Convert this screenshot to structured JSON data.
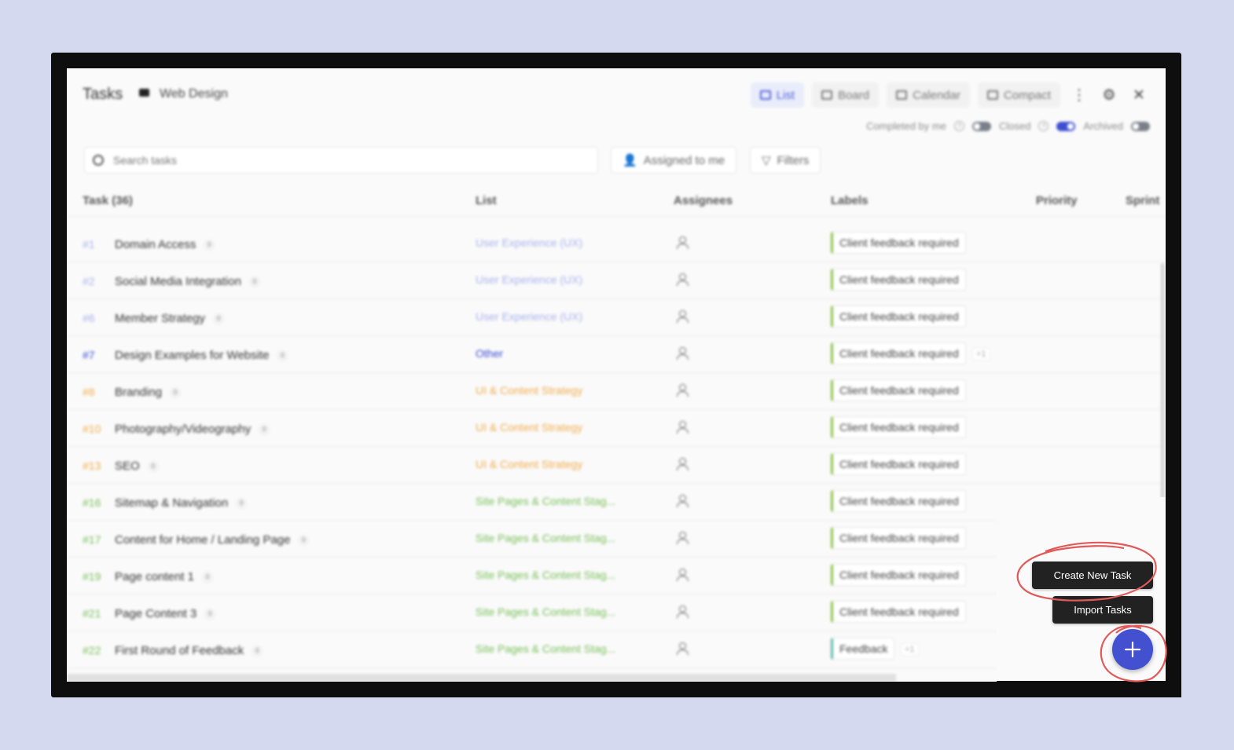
{
  "header": {
    "title": "Tasks",
    "project_name": "Web Design"
  },
  "views": [
    {
      "label": "List",
      "active": true
    },
    {
      "label": "Board",
      "active": false
    },
    {
      "label": "Calendar",
      "active": false
    },
    {
      "label": "Compact",
      "active": false
    }
  ],
  "toggles": [
    {
      "label": "Completed by me",
      "on": false
    },
    {
      "label": "Closed",
      "on": true
    },
    {
      "label": "Archived",
      "on": false
    }
  ],
  "search": {
    "placeholder": "Search tasks"
  },
  "filters": {
    "assigned_label": "Assigned to me",
    "filters_label": "Filters"
  },
  "table": {
    "columns": {
      "task": "Task (36)",
      "list": "List",
      "assignees": "Assignees",
      "labels": "Labels",
      "priority": "Priority",
      "sprint": "Sprint"
    },
    "rows": [
      {
        "id": "#1",
        "name": "Domain Access",
        "count": "0",
        "list": "User Experience (UX)",
        "list_color": "#aab2ec",
        "label": "Client feedback required",
        "label_color": "#8bc34a",
        "extra": ""
      },
      {
        "id": "#2",
        "name": "Social Media Integration",
        "count": "0",
        "list": "User Experience (UX)",
        "list_color": "#aab2ec",
        "label": "Client feedback required",
        "label_color": "#8bc34a",
        "extra": ""
      },
      {
        "id": "#6",
        "name": "Member Strategy",
        "count": "0",
        "list": "User Experience (UX)",
        "list_color": "#aab2ec",
        "label": "Client feedback required",
        "label_color": "#8bc34a",
        "extra": ""
      },
      {
        "id": "#7",
        "name": "Design Examples for Website",
        "count": "0",
        "list": "Other",
        "list_color": "#3a4ad0",
        "label": "Client feedback required",
        "label_color": "#8bc34a",
        "extra": "+1"
      },
      {
        "id": "#8",
        "name": "Branding",
        "count": "0",
        "list": "UI & Content Strategy",
        "list_color": "#f1ac4c",
        "label": "Client feedback required",
        "label_color": "#8bc34a",
        "extra": ""
      },
      {
        "id": "#10",
        "name": "Photography/Videography",
        "count": "0",
        "list": "UI & Content Strategy",
        "list_color": "#f1ac4c",
        "label": "Client feedback required",
        "label_color": "#8bc34a",
        "extra": ""
      },
      {
        "id": "#13",
        "name": "SEO",
        "count": "0",
        "list": "UI & Content Strategy",
        "list_color": "#f1ac4c",
        "label": "Client feedback required",
        "label_color": "#8bc34a",
        "extra": ""
      },
      {
        "id": "#16",
        "name": "Sitemap & Navigation",
        "count": "0",
        "list": "Site Pages & Content Stag...",
        "list_color": "#78c05a",
        "label": "Client feedback required",
        "label_color": "#8bc34a",
        "extra": ""
      },
      {
        "id": "#17",
        "name": "Content for Home / Landing Page",
        "count": "0",
        "list": "Site Pages & Content Stag...",
        "list_color": "#78c05a",
        "label": "Client feedback required",
        "label_color": "#8bc34a",
        "extra": ""
      },
      {
        "id": "#19",
        "name": "Page content 1",
        "count": "0",
        "list": "Site Pages & Content Stag...",
        "list_color": "#78c05a",
        "label": "Client feedback required",
        "label_color": "#8bc34a",
        "extra": ""
      },
      {
        "id": "#21",
        "name": "Page Content 3",
        "count": "0",
        "list": "Site Pages & Content Stag...",
        "list_color": "#78c05a",
        "label": "Client feedback required",
        "label_color": "#8bc34a",
        "extra": ""
      },
      {
        "id": "#22",
        "name": "First Round of Feedback",
        "count": "0",
        "list": "Site Pages & Content Stag...",
        "list_color": "#78c05a",
        "label": "Feedback",
        "label_color": "#5fb8a8",
        "extra": "+1"
      }
    ]
  },
  "actions": {
    "create_task": "Create New Task",
    "import_tasks": "Import Tasks"
  },
  "colors": {
    "accent": "#4350d0",
    "annotation": "#e05a5a"
  }
}
